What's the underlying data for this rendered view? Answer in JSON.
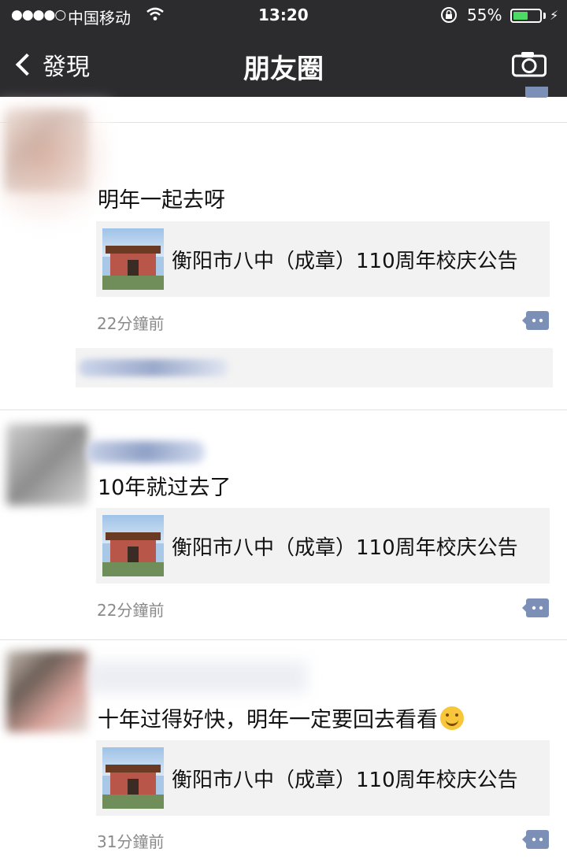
{
  "status_bar": {
    "signal": "●●●●○",
    "carrier": "中国移动",
    "time": "13:20",
    "battery_percent": "55%",
    "battery_level": 0.55,
    "wifi_icon": "wifi-icon",
    "lock_icon": "orientation-lock-icon",
    "charging_icon": "bolt-icon"
  },
  "nav": {
    "back_label": "發現",
    "title": "朋友圈",
    "back_icon": "chevron-left-icon",
    "action_icon": "camera-icon"
  },
  "posts": [
    {
      "text": "明年一起去呀",
      "link_title": "衡阳市八中（成章）110周年校庆公告",
      "time": "22分鐘前"
    },
    {
      "text": "10年就过去了",
      "link_title": "衡阳市八中（成章）110周年校庆公告",
      "time": "22分鐘前"
    },
    {
      "text": "十年过得好快，明年一定要回去看看",
      "link_title": "衡阳市八中（成章）110周年校庆公告",
      "time": "31分鐘前"
    }
  ],
  "colors": {
    "nav_background": "#2c2c2e",
    "link_card_background": "#f2f2f2",
    "time_text": "#8a8a8a",
    "comment_button": "#7b8fb7",
    "battery_fill": "#4cd964"
  }
}
